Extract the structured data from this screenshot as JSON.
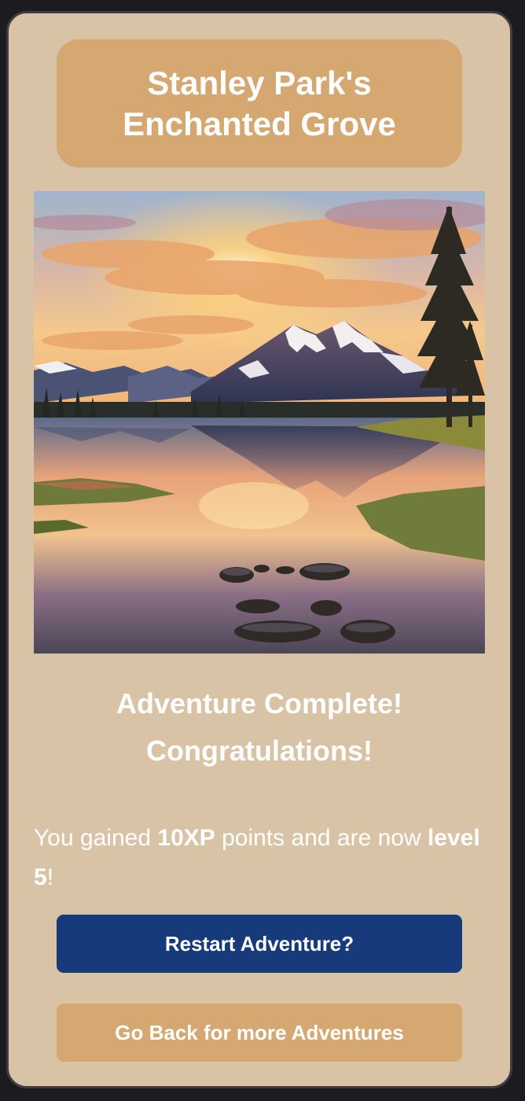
{
  "header": {
    "title_line1": "Stanley Park's",
    "title_line2": "Enchanted Grove"
  },
  "scene": {
    "icon": "mountain-lake-sunset-scene",
    "colors": {
      "sky_top": "#a9b8cf",
      "sun_glow": "#ffd27a",
      "cloud": "#e8a46a",
      "mountain": "#3a3f5c",
      "snow": "#f1eef0",
      "water": "#c98e6a",
      "tree": "#2c2a22"
    }
  },
  "result": {
    "heading_line1": "Adventure Complete!",
    "heading_line2": "Congratulations!",
    "text_prefix": "You gained ",
    "xp": "10XP",
    "text_middle": " points and are now ",
    "level": "level 5",
    "text_suffix": "!"
  },
  "actions": {
    "restart_label": "Restart Adventure?",
    "back_label": "Go Back for more Adventures"
  },
  "theme": {
    "page_bg": "#1c1b1f",
    "card_bg": "#d8c3a6",
    "accent_tan": "#d6a871",
    "primary_blue": "#173a7a"
  }
}
